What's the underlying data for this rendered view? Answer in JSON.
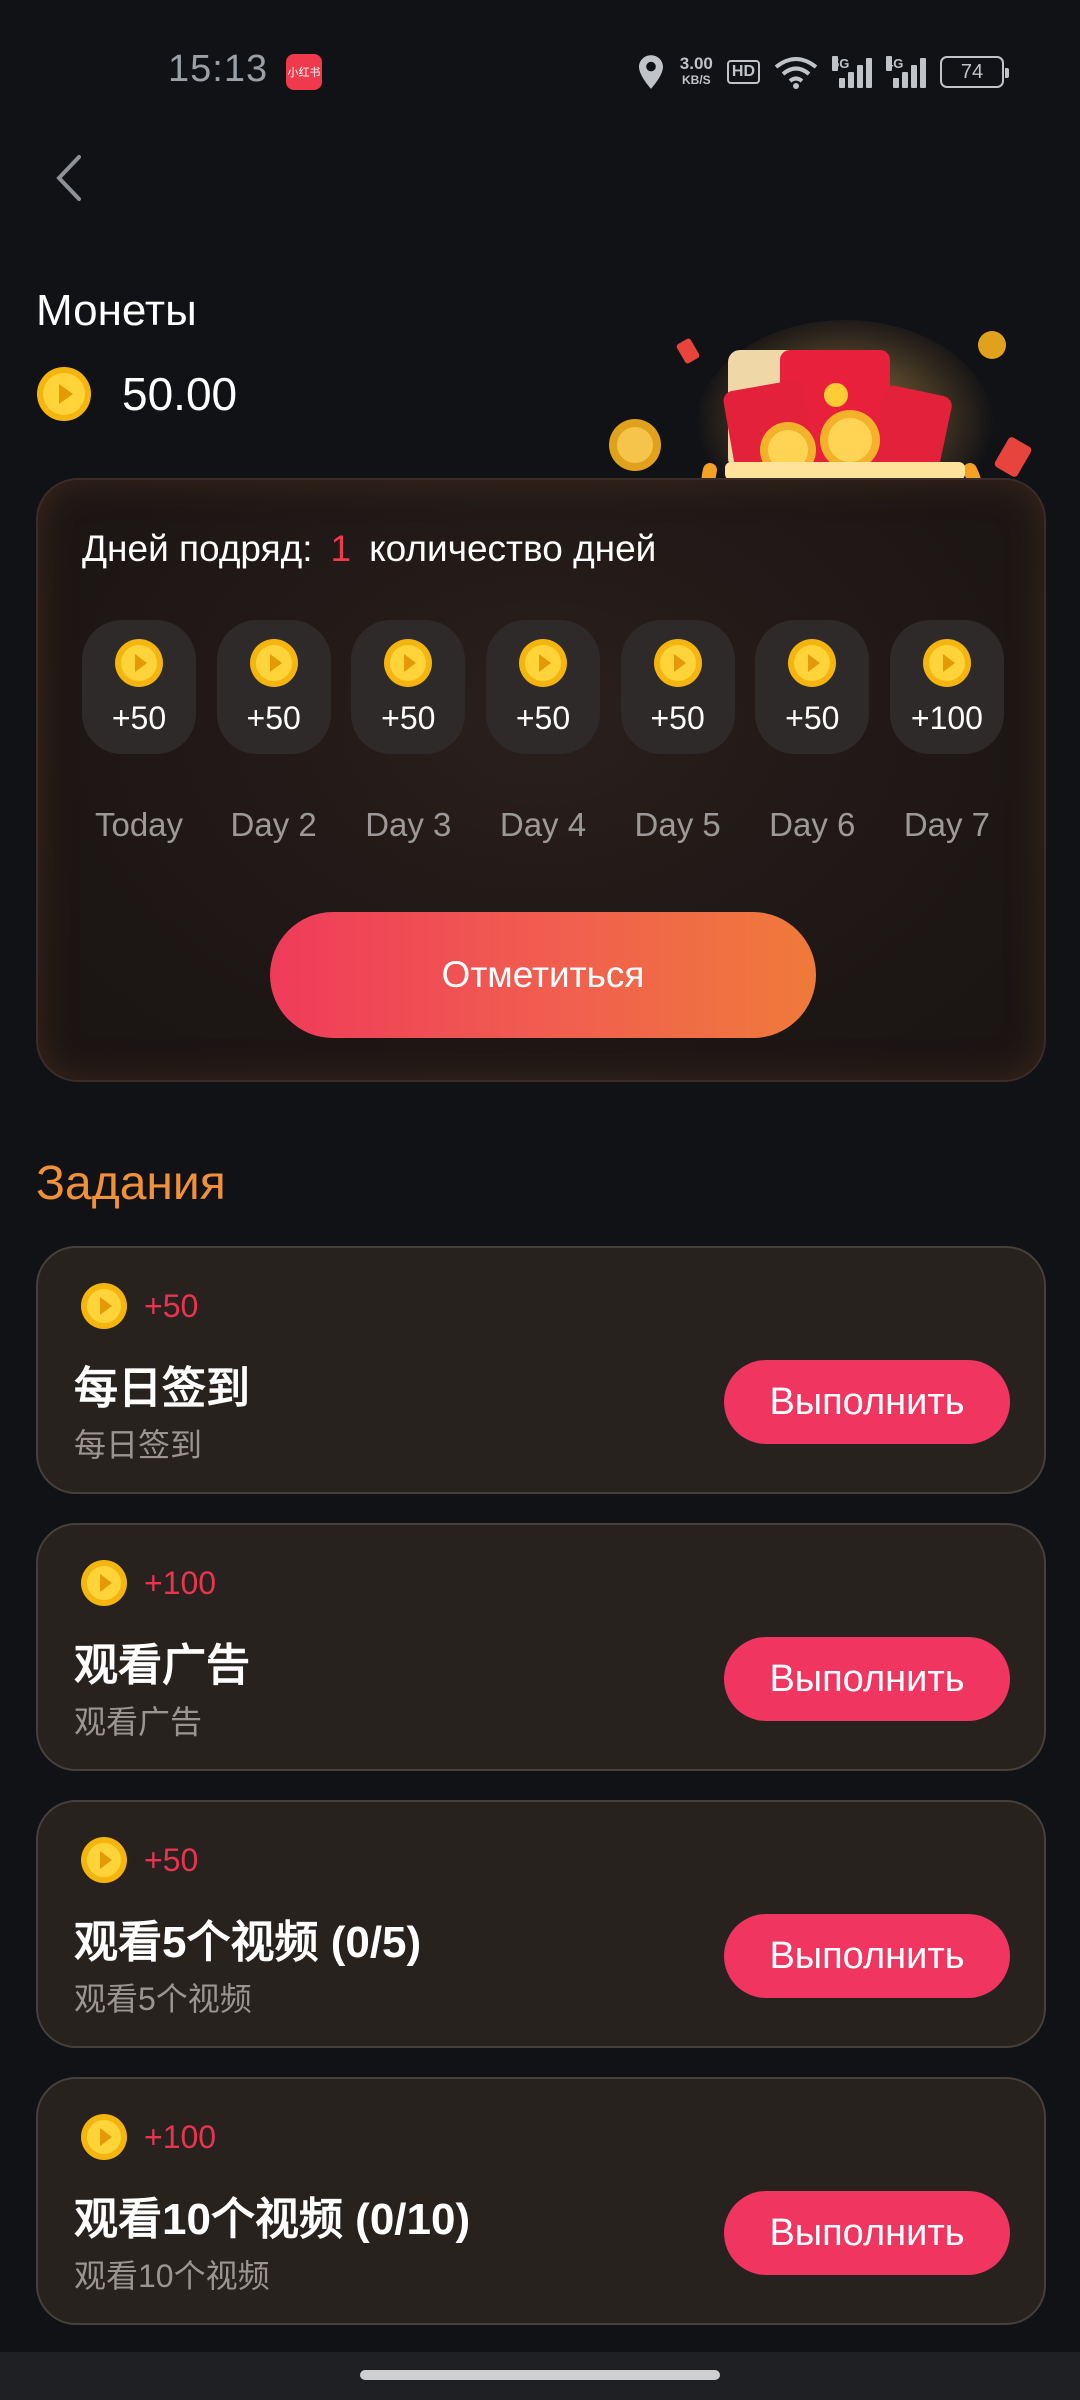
{
  "status_bar": {
    "time": "15:13",
    "app_icon_text": "小红书",
    "net_speed_value": "3.00",
    "net_speed_unit": "KB/S",
    "hd_label": "HD",
    "signal1_label": "5G",
    "signal2_label": "4G",
    "battery": "74"
  },
  "header": {
    "title": "Монеты",
    "balance": "50.00"
  },
  "checkin": {
    "streak_prefix": "Дней подряд:",
    "streak_count": "1",
    "streak_suffix": "количество дней",
    "days": [
      {
        "reward": "+50",
        "label": "Today"
      },
      {
        "reward": "+50",
        "label": "Day 2"
      },
      {
        "reward": "+50",
        "label": "Day 3"
      },
      {
        "reward": "+50",
        "label": "Day 4"
      },
      {
        "reward": "+50",
        "label": "Day 5"
      },
      {
        "reward": "+50",
        "label": "Day 6"
      },
      {
        "reward": "+100",
        "label": "Day 7"
      }
    ],
    "button_label": "Отметиться"
  },
  "tasks": {
    "title": "Задания",
    "items": [
      {
        "reward": "+50",
        "name": "每日签到",
        "desc": "每日签到",
        "button": "Выполнить"
      },
      {
        "reward": "+100",
        "name": "观看广告",
        "desc": "观看广告",
        "button": "Выполнить"
      },
      {
        "reward": "+50",
        "name": "观看5个视频 (0/5)",
        "desc": "观看5个视频",
        "button": "Выполнить"
      },
      {
        "reward": "+100",
        "name": "观看10个视频 (0/10)",
        "desc": "观看10个视频",
        "button": "Выполнить"
      }
    ]
  },
  "colors": {
    "background": "#111216",
    "accent_red": "#ef3560",
    "accent_orange": "#f0913a",
    "coin_gold": "#f7c21c"
  },
  "icons": [
    "back-chevron-icon",
    "coin-icon",
    "location-icon",
    "wifi-icon",
    "signal-icon",
    "battery-icon",
    "gift-box-icon"
  ]
}
